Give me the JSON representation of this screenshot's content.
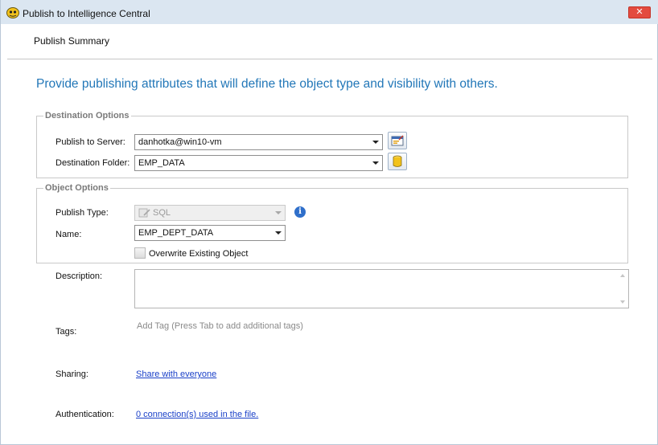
{
  "window": {
    "title": "Publish to Intelligence Central",
    "close_label": "✕"
  },
  "header": {
    "section": "Publish Summary"
  },
  "intro": "Provide publishing attributes that will define the object type and visibility with others.",
  "destination": {
    "legend": "Destination Options",
    "server_label": "Publish to Server:",
    "server_value": "danhotka@win10-vm",
    "folder_label": "Destination Folder:",
    "folder_value": "EMP_DATA"
  },
  "object": {
    "legend": "Object Options",
    "type_label": "Publish Type:",
    "type_value": "SQL",
    "name_label": "Name:",
    "name_value": "EMP_DEPT_DATA",
    "overwrite_label": "Overwrite Existing Object",
    "overwrite_checked": false
  },
  "description": {
    "label": "Description:",
    "value": ""
  },
  "tags": {
    "label": "Tags:",
    "placeholder": "Add Tag (Press Tab to add additional tags)"
  },
  "sharing": {
    "label": "Sharing:",
    "link": "Share with everyone"
  },
  "authentication": {
    "label": "Authentication:",
    "link": "0 connection(s) used in the file."
  },
  "colors": {
    "accent": "#2277b8",
    "link": "#1a40c8",
    "close": "#e34b3f",
    "titlebar": "#dbe6f1"
  }
}
